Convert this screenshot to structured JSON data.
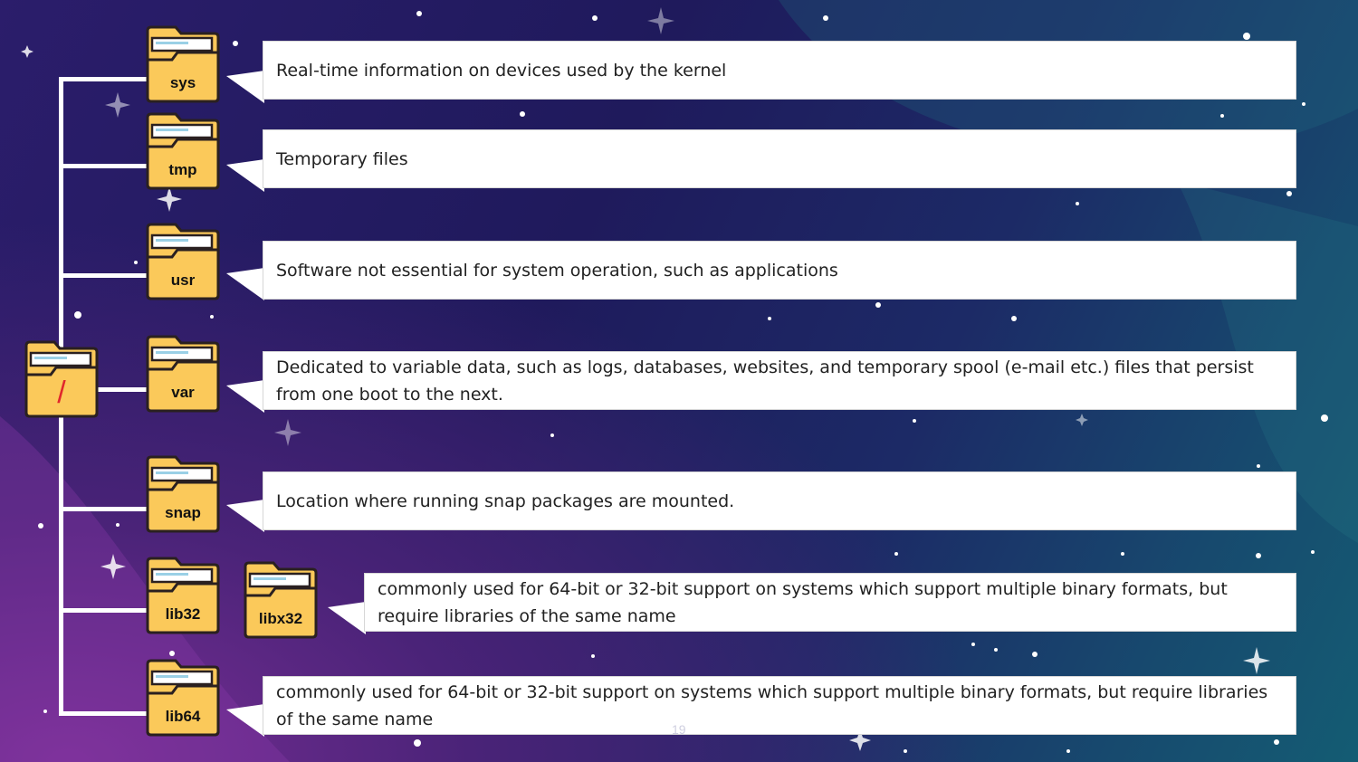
{
  "root": {
    "label": "/"
  },
  "folders": [
    {
      "name": "sys",
      "description": "Real-time information on devices used by the kernel"
    },
    {
      "name": "tmp",
      "description": "Temporary files"
    },
    {
      "name": "usr",
      "description": "Software not essential for system operation, such as applications"
    },
    {
      "name": "var",
      "description": "Dedicated to variable data, such as logs, databases, websites, and temporary spool (e-mail etc.) files that persist from one boot to the next."
    },
    {
      "name": "snap",
      "description": "Location where running snap packages are mounted."
    },
    {
      "name": "lib32",
      "sub": "libx32",
      "description": "commonly used for 64-bit or 32-bit support on systems which support multiple binary formats, but require libraries of the same name"
    },
    {
      "name": "lib64",
      "description": "commonly used for 64-bit or 32-bit support on systems which support multiple binary formats, but require libraries of the same name"
    }
  ],
  "slide_number": "19",
  "colors": {
    "folder": "#fbc95a",
    "folder_outline": "#2a2020",
    "root_label": "#e0262c"
  }
}
